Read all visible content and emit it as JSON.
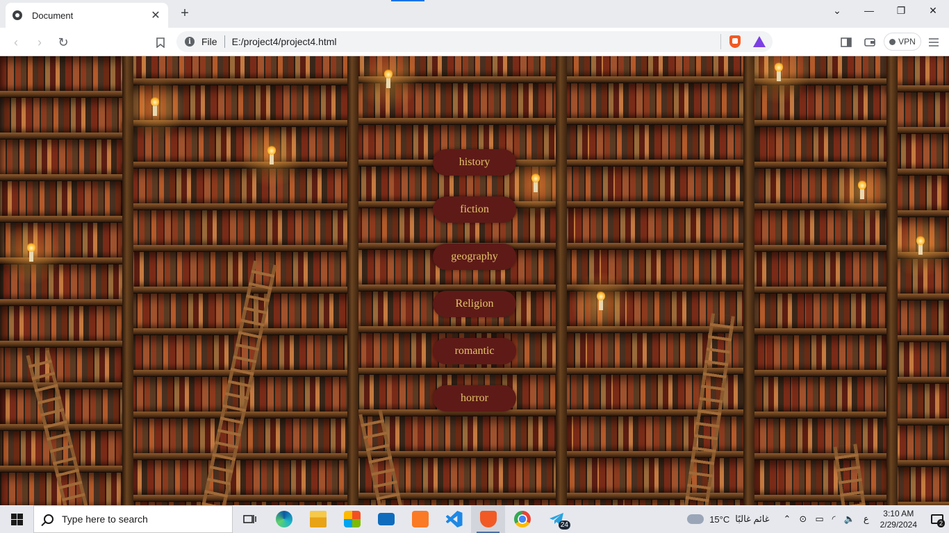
{
  "browser": {
    "tab_title": "Document",
    "tab_close": "✕",
    "new_tab": "+",
    "window_controls": {
      "minimize": "—",
      "restore": "❐",
      "close": "✕",
      "tab_search": "⌄"
    },
    "nav": {
      "back": "‹",
      "forward": "›",
      "reload": "↻",
      "bookmark": "☐"
    },
    "address": {
      "scheme_label": "File",
      "url": "E:/project4/project4.html",
      "info_icon": "i"
    },
    "vpn_label": "VPN",
    "icons": [
      "sidebar-icon",
      "wallet-icon",
      "menu-icon"
    ]
  },
  "page": {
    "categories": [
      {
        "label": "history"
      },
      {
        "label": "fiction"
      },
      {
        "label": "geography"
      },
      {
        "label": "Religion"
      },
      {
        "label": "romantic"
      },
      {
        "label": "horror"
      }
    ],
    "button_bg": "#5e1a17",
    "button_text_color": "#e4c36a"
  },
  "taskbar": {
    "search_placeholder": "Type here to search",
    "apps": [
      {
        "name": "task-view"
      },
      {
        "name": "edge"
      },
      {
        "name": "file-explorer"
      },
      {
        "name": "microsoft-store"
      },
      {
        "name": "mail"
      },
      {
        "name": "xampp"
      },
      {
        "name": "vscode"
      },
      {
        "name": "brave",
        "active": true
      },
      {
        "name": "chrome"
      },
      {
        "name": "telegram",
        "badge": "24"
      }
    ],
    "weather": {
      "temp": "15°C",
      "desc": "غائم غالبًا"
    },
    "lang": "ع",
    "time": "3:10 AM",
    "date": "2/29/2024",
    "notifications": "2"
  }
}
